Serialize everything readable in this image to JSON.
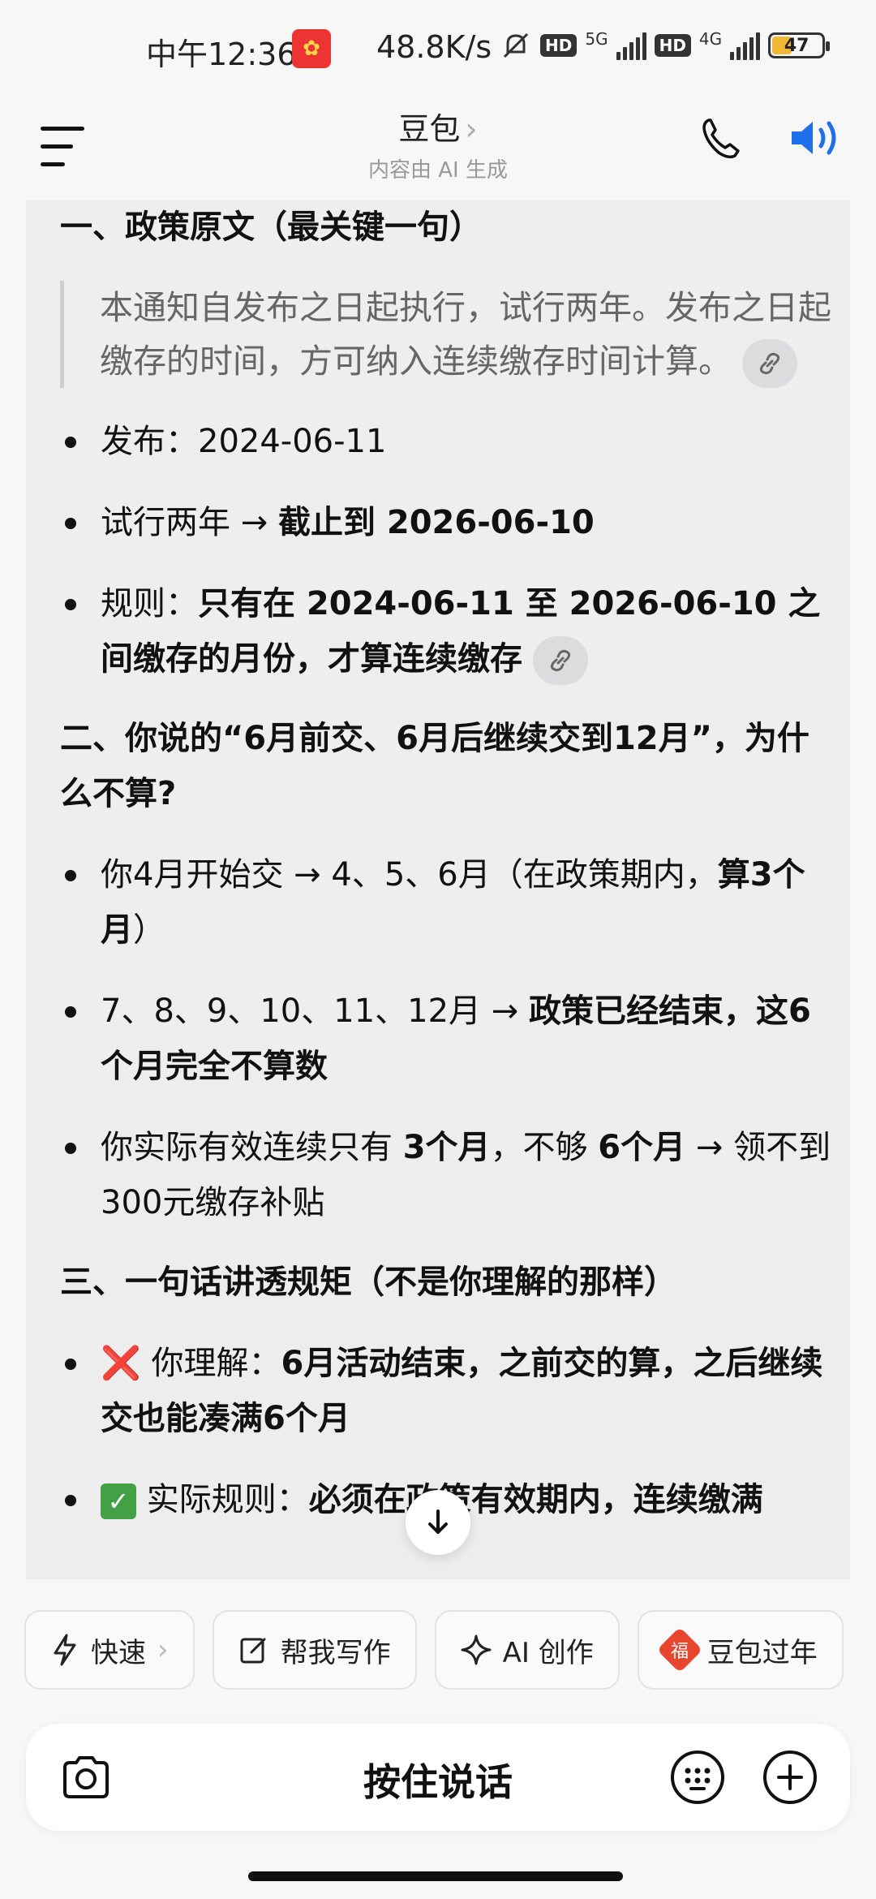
{
  "status_bar": {
    "time": "中午12:36",
    "speed": "48.8K/s",
    "hd1": "HD",
    "net1": "5G",
    "hd2": "HD",
    "net2": "4G",
    "battery": "47"
  },
  "header": {
    "title": "豆包",
    "title_chevron": "›",
    "subtitle": "内容由 AI 生成"
  },
  "message": {
    "section1_title": "一、政策原文（最关键一句）",
    "quote": "本通知自发布之日起执行，试行两年。发布之日起缴存的时间，方可纳入连续缴存时间计算。",
    "s1_b1": "发布：2024-06-11",
    "s1_b2_plain": "试行两年 → ",
    "s1_b2_bold": "截止到 2026-06-10",
    "s1_b3_plain": "规则：",
    "s1_b3_bold": "只有在 2024-06-11 至 2026-06-10 之间缴存的月份，才算连续缴存",
    "section2_title": "二、你说的“6月前交、6月后继续交到12月”，为什么不算?",
    "s2_b1_plain": "你4月开始交 → 4、5、6月（在政策期内，",
    "s2_b1_bold": "算3个月",
    "s2_b1_end": "）",
    "s2_b2_plain": "7、8、9、10、11、12月 → ",
    "s2_b2_bold": "政策已经结束，这6个月完全不算数",
    "s2_b3_a": "你实际有效连续只有 ",
    "s2_b3_b": "3个月",
    "s2_b3_c": "，不够 ",
    "s2_b3_d": "6个月",
    "s2_b3_e": " → 领不到300元缴存补贴",
    "section3_title": "三、一句话讲透规矩（不是你理解的那样）",
    "s3_b1_icon": "❌",
    "s3_b1_plain": " 你理解：",
    "s3_b1_bold": "6月活动结束，之前交的算，之后继续交也能凑满6个月",
    "s3_b2_icon": "✓",
    "s3_b2_plain": " 实际规则：",
    "s3_b2_bold": "必须在政策有效期内，连续缴满"
  },
  "chips": [
    {
      "label": "快速",
      "icon": "lightning-icon",
      "chevron": "›"
    },
    {
      "label": "帮我写作",
      "icon": "edit-icon"
    },
    {
      "label": "AI 创作",
      "icon": "sparkle-icon"
    },
    {
      "label": "豆包过年",
      "icon": "fu-icon",
      "icon_text": "福"
    }
  ],
  "input": {
    "hold_to_talk": "按住说话"
  }
}
